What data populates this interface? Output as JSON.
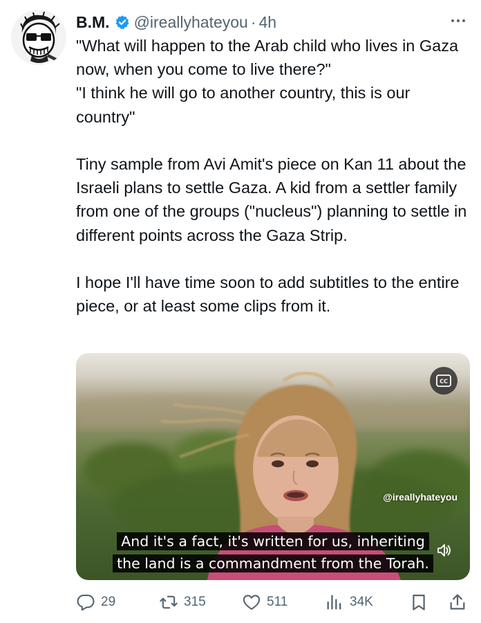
{
  "author": {
    "name": "B.M.",
    "handle": "@ireallyhateyou",
    "separator": "·",
    "time": "4h"
  },
  "tweet": {
    "text": "\"What will happen to the Arab child who lives in Gaza now, when you come to live there?\"\n\"I think he will go to another country, this is our country\"\n\nTiny sample from Avi Amit's piece on Kan 11 about the Israeli plans to settle Gaza. A kid from a settler family from one of the groups (\"nucleus\") planning to settle in different points across the Gaza Strip.\n\nI hope I'll have time soon to add subtitles to the entire piece, or at least some clips from it."
  },
  "media": {
    "cc_label": "CC",
    "watermark": "@ireallyhateyou",
    "subtitle_line1": "And it's a fact, it's written for us, inheriting",
    "subtitle_line2": "the land is a commandment from the Torah."
  },
  "actions": {
    "replies": "29",
    "reposts": "315",
    "likes": "511",
    "views": "34K"
  },
  "icons": {
    "verified": "verified-badge-icon",
    "more": "more-horizontal-icon",
    "reply": "reply-icon",
    "repost": "repost-icon",
    "like": "heart-icon",
    "views": "views-chart-icon",
    "bookmark": "bookmark-icon",
    "share": "share-icon",
    "cc": "closed-captions-icon",
    "volume": "volume-icon"
  },
  "colors": {
    "text": "#0f1419",
    "secondary": "#536471",
    "verified": "#1d9bf0"
  }
}
